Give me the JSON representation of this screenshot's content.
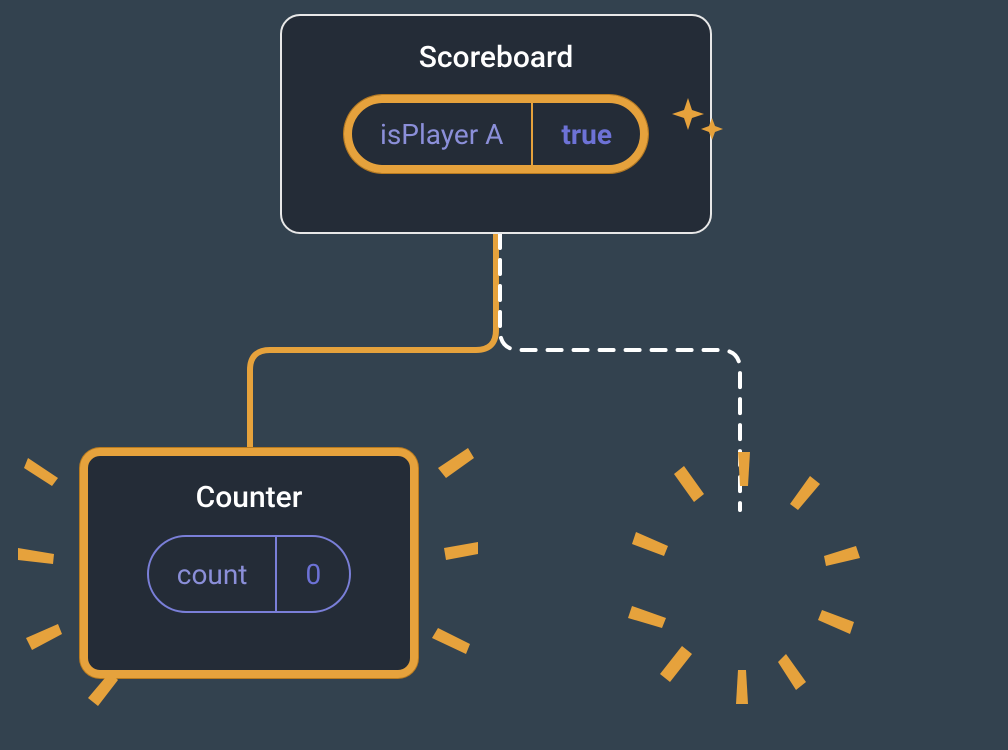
{
  "scoreboard": {
    "title": "Scoreboard",
    "state_label": "isPlayer A",
    "state_value": "true"
  },
  "counter": {
    "title": "Counter",
    "state_label": "count",
    "state_value": "0"
  },
  "colors": {
    "bg": "#33424f",
    "node_bg": "#242c37",
    "highlight": "#e6a23c",
    "text": "#ffffff",
    "purple": "#8b8fd9",
    "purple_bold": "#6d72d6"
  }
}
